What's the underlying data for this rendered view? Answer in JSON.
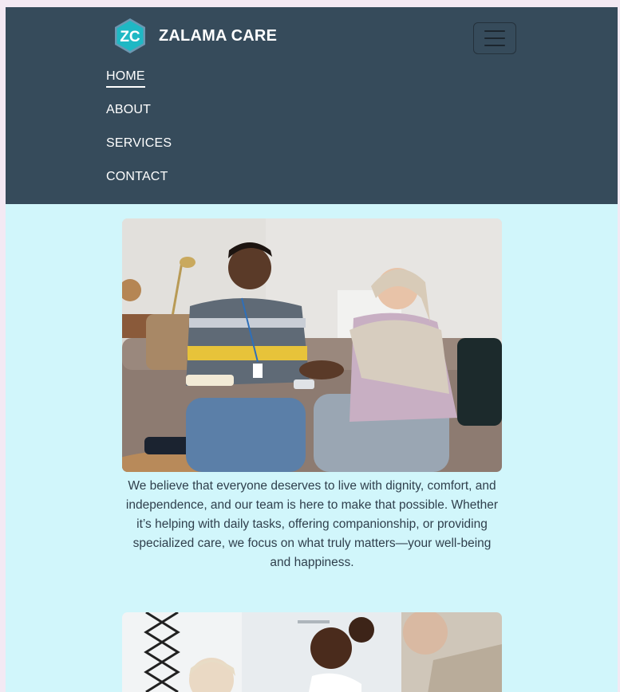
{
  "navbar": {
    "brand_name": "ZALAMA CARE",
    "logo_initials": "ZC",
    "logo_icon": "zc-hexagon-logo-icon",
    "menu_icon": "hamburger-menu-icon",
    "links": [
      {
        "label": "HOME",
        "active": true
      },
      {
        "label": "ABOUT",
        "active": false
      },
      {
        "label": "SERVICES",
        "active": false
      },
      {
        "label": "CONTACT",
        "active": false
      }
    ]
  },
  "main": {
    "cards": [
      {
        "image": "photo-caregiver-with-elderly-woman",
        "text": "We believe that everyone deserves to live with dignity, comfort, and independence, and our team is here to make that possible. Whether it’s helping with daily tasks, offering companionship, or providing specialized care, we focus on what truly matters—your well-being and happiness."
      },
      {
        "image": "photo-caregivers-with-patient"
      }
    ]
  },
  "colors": {
    "navbar_bg": "#364b5b",
    "page_bg": "#d1f6fb",
    "outer_bg": "#f3e9f3",
    "text": "#2f3f4c",
    "logo_teal": "#1fb8c4"
  }
}
